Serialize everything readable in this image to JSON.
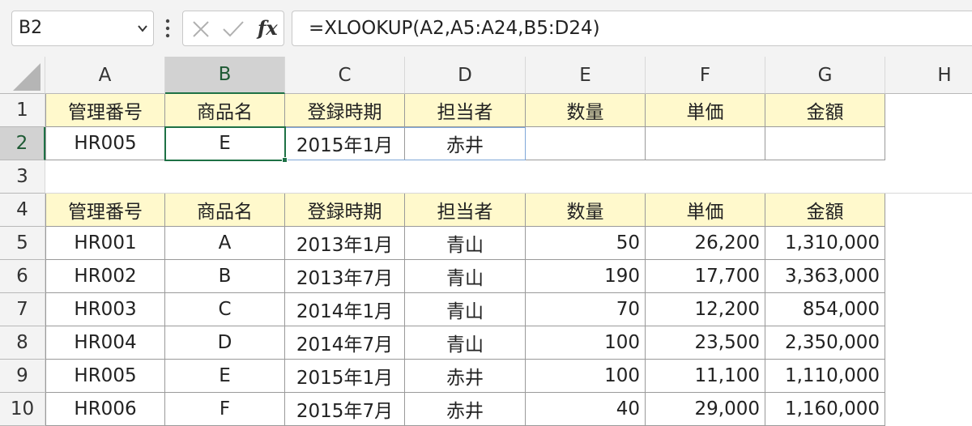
{
  "formula_bar": {
    "namebox": "B2",
    "formula": "=XLOOKUP(A2,A5:A24,B5:D24)",
    "fx_label": "fx"
  },
  "columns": [
    "A",
    "B",
    "C",
    "D",
    "E",
    "F",
    "G",
    "H"
  ],
  "rows": [
    "1",
    "2",
    "3",
    "4",
    "5",
    "6",
    "7",
    "8",
    "9",
    "10"
  ],
  "lookup_table": {
    "headers": [
      "管理番号",
      "商品名",
      "登録時期",
      "担当者",
      "数量",
      "単価",
      "金額"
    ],
    "values": [
      "HR005",
      "E",
      "2015年1月",
      "赤井",
      "",
      "",
      ""
    ]
  },
  "data_table": {
    "headers": [
      "管理番号",
      "商品名",
      "登録時期",
      "担当者",
      "数量",
      "単価",
      "金額"
    ],
    "rows": [
      [
        "HR001",
        "A",
        "2013年1月",
        "青山",
        "50",
        "26,200",
        "1,310,000"
      ],
      [
        "HR002",
        "B",
        "2013年7月",
        "青山",
        "190",
        "17,700",
        "3,363,000"
      ],
      [
        "HR003",
        "C",
        "2014年1月",
        "青山",
        "70",
        "12,200",
        "854,000"
      ],
      [
        "HR004",
        "D",
        "2014年7月",
        "青山",
        "100",
        "23,500",
        "2,350,000"
      ],
      [
        "HR005",
        "E",
        "2015年1月",
        "赤井",
        "100",
        "11,100",
        "1,110,000"
      ],
      [
        "HR006",
        "F",
        "2015年7月",
        "赤井",
        "40",
        "29,000",
        "1,160,000"
      ]
    ]
  },
  "colors": {
    "accent": "#1e7145",
    "header_fill": "#fff9cc",
    "spill": "#7fa7d8"
  }
}
